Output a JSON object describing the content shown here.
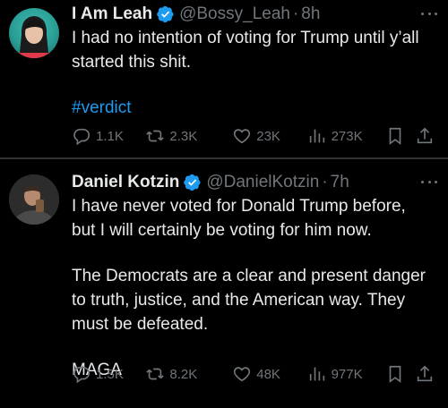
{
  "tweets": [
    {
      "name": "I Am Leah",
      "handle": "@Bossy_Leah",
      "separator": "·",
      "time": "8h",
      "lines": [
        "I had no intention of voting for Trump until y’all",
        "started this shit."
      ],
      "hashtag": "#verdict",
      "stats": {
        "replies": "1.1K",
        "reposts": "2.3K",
        "likes": "23K",
        "views": "273K"
      },
      "icons": [
        "reply-icon",
        "repost-icon",
        "like-icon",
        "views-icon",
        "bookmark-icon",
        "share-icon"
      ]
    },
    {
      "name": "Daniel Kotzin",
      "handle": "@DanielKotzin",
      "separator": "·",
      "time": "7h",
      "paragraphs": [
        [
          "I have never voted for Donald Trump before,",
          "but I will certainly be voting for him now."
        ],
        [
          "The Democrats are a clear and present danger",
          "to truth, justice, and the American way. They",
          "must be defeated."
        ],
        [
          "MAGA"
        ]
      ],
      "stats": {
        "replies": "1.5K",
        "reposts": "8.2K",
        "likes": "48K",
        "views": "977K"
      },
      "icons": [
        "reply-icon",
        "repost-icon",
        "like-icon",
        "views-icon",
        "bookmark-icon",
        "share-icon"
      ]
    }
  ],
  "colors": {
    "background": "#000000",
    "text": "#e7e9ea",
    "muted": "#71767b",
    "accent": "#1d9bf0",
    "divider": "#2f3336"
  }
}
